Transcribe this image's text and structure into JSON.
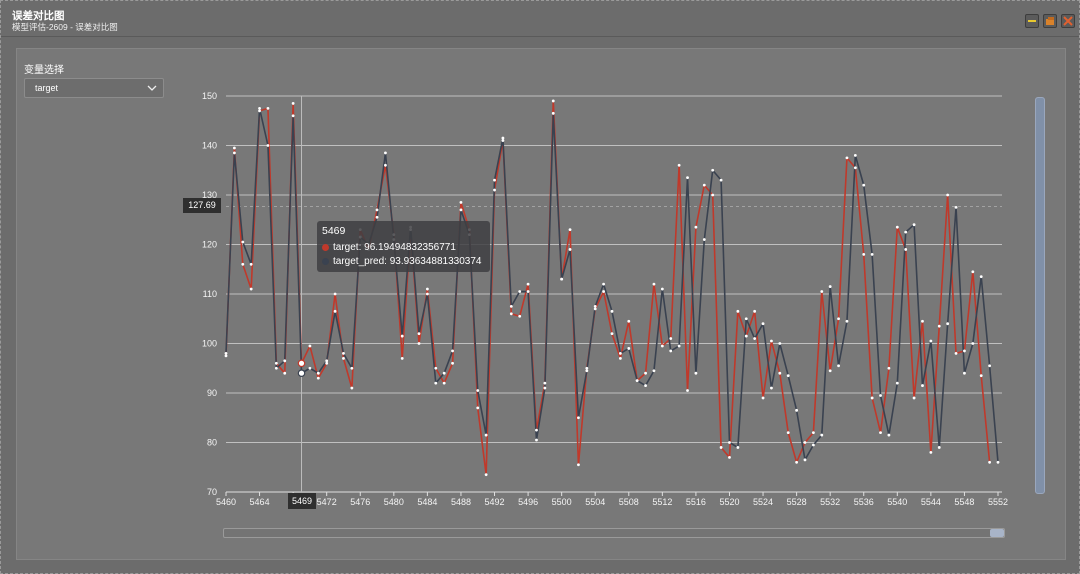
{
  "window": {
    "title": "误差对比图",
    "subtitle": "模型评估-2609 - 误差对比图",
    "buttons": [
      "minimize-icon",
      "restore-icon",
      "close-icon"
    ]
  },
  "controls": {
    "variable_label": "变量选择",
    "variable_value": "target"
  },
  "tooltip": {
    "header": "5469",
    "rows": [
      {
        "name": "target",
        "value": "96.19494832356771",
        "color": "#c0392b"
      },
      {
        "name": "target_pred",
        "value": "93.93634881330374",
        "color": "#3a4250"
      }
    ]
  },
  "crosshair": {
    "y_label": "127.69",
    "x_label": "5469"
  },
  "chart_data": {
    "type": "line",
    "title": "",
    "xlabel": "",
    "ylabel": "",
    "xlim": [
      5460,
      5552
    ],
    "ylim": [
      70,
      150
    ],
    "y_ticks": [
      "70",
      "80",
      "90",
      "100",
      "110",
      "120",
      "130",
      "140",
      "150"
    ],
    "x_ticks": [
      "5460",
      "5464",
      "5468",
      "5472",
      "5476",
      "5480",
      "5484",
      "5488",
      "5492",
      "5496",
      "5500",
      "5504",
      "5508",
      "5512",
      "5516",
      "5520",
      "5524",
      "5528",
      "5532",
      "5536",
      "5540",
      "5544",
      "5548",
      "5552"
    ],
    "x_tick_labels_shown": [
      "5460",
      "5464",
      "",
      "5472",
      "5476",
      "5480",
      "5484",
      "5488",
      "5492",
      "5496",
      "5500",
      "5504",
      "5508",
      "5512",
      "5516",
      "5520",
      "5524",
      "5528",
      "5532",
      "5536",
      "5540",
      "5544",
      "5548",
      "5552"
    ],
    "x_start": 5460,
    "grid": true,
    "colors": {
      "target": "#c0392b",
      "target_pred": "#3a4250",
      "grid": "#d8d8d8"
    },
    "series": [
      {
        "name": "target",
        "values": [
          97.5,
          139.5,
          116,
          111,
          147,
          147.5,
          96,
          94,
          148.5,
          96,
          99.5,
          93,
          96,
          110,
          97,
          91,
          123,
          119,
          127,
          136,
          122,
          97,
          123,
          100,
          111,
          95,
          92,
          96,
          128.5,
          123,
          87,
          73.5,
          131,
          141,
          106,
          105.5,
          112,
          82.5,
          92,
          149,
          113,
          123,
          75.5,
          95,
          107,
          110.5,
          102,
          97,
          104.5,
          92.5,
          94,
          112,
          99.5,
          101,
          136,
          90.5,
          123.5,
          132,
          130,
          79,
          77,
          106.5,
          101.5,
          106.5,
          89,
          100.5,
          94,
          82,
          76,
          80,
          82,
          110.5,
          94.5,
          105,
          137.5,
          135.5,
          118,
          89,
          82,
          95,
          123.5,
          119,
          89,
          104.5,
          78,
          103.5,
          130,
          98,
          98.5,
          114.5,
          93.5,
          76
        ]
      },
      {
        "name": "target_pred",
        "values": [
          98,
          138.5,
          120.5,
          116,
          147.5,
          140,
          95,
          96.5,
          146,
          94,
          95,
          94,
          96.5,
          106.5,
          98,
          95,
          121.5,
          120,
          125.5,
          138.5,
          121,
          101.5,
          123.5,
          102,
          110,
          92,
          94,
          98.5,
          127,
          122,
          90.5,
          81.5,
          133,
          141.5,
          107.5,
          110.5,
          110.5,
          80.5,
          91,
          146.5,
          113,
          119,
          85,
          94.5,
          107.5,
          112,
          106.5,
          98,
          99,
          92.5,
          91.5,
          94.5,
          111,
          98.5,
          99.5,
          133.5,
          94,
          121,
          135,
          133,
          80,
          79,
          105,
          101,
          104,
          91,
          100,
          93.5,
          86.5,
          76.5,
          79.5,
          81.5,
          111.5,
          95.5,
          104.5,
          138,
          132,
          118,
          89.5,
          81.5,
          92,
          122.5,
          124,
          91.5,
          100.5,
          79,
          104,
          127.5,
          94,
          100,
          113.5,
          95.5,
          76
        ]
      }
    ]
  }
}
